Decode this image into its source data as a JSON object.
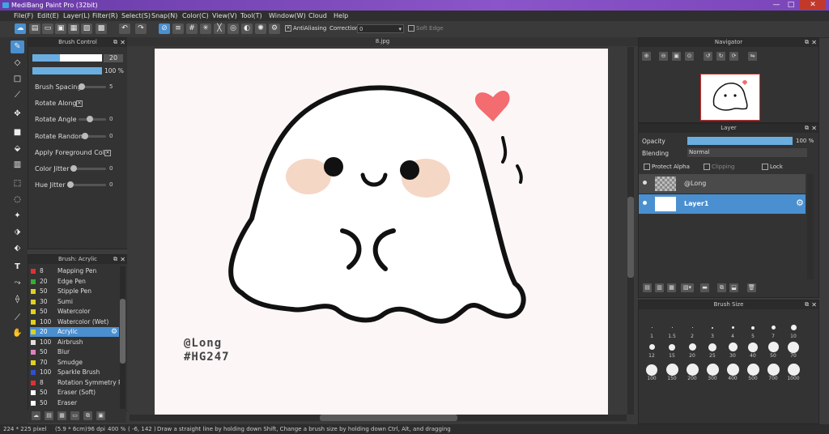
{
  "window": {
    "title": "MediBang Paint Pro (32bit)",
    "controls": [
      "—",
      "□",
      "✕"
    ]
  },
  "menu": [
    "File(F)",
    "Edit(E)",
    "Layer(L)",
    "Filter(R)",
    "Select(S)",
    "Snap(N)",
    "Color(C)",
    "View(V)",
    "Tool(T)",
    "Window(W)",
    "Cloud",
    "Help"
  ],
  "toolbar": {
    "antialiasing_label": "AntiAliasing",
    "correction_label": "Correction",
    "correction_value": "0",
    "soft_edge_label": "Soft Edge"
  },
  "brush_control": {
    "title": "Brush Control",
    "size_value": "20",
    "opacity_value": "100 %",
    "rows": [
      {
        "label": "Brush Spacing",
        "value": "5"
      },
      {
        "label": "Rotate Along",
        "value": ""
      },
      {
        "label": "Rotate Angle",
        "value": "0"
      },
      {
        "label": "Rotate Random",
        "value": "0"
      },
      {
        "label": "Apply Foreground Color",
        "value": ""
      },
      {
        "label": "Color Jitter",
        "value": "0"
      },
      {
        "label": "Hue Jitter",
        "value": "0"
      }
    ]
  },
  "brush_list": {
    "title": "Brush: Acrylic",
    "items": [
      {
        "size": "8",
        "name": "Mapping Pen",
        "color": "#e03030"
      },
      {
        "size": "20",
        "name": "Edge Pen",
        "color": "#30b030"
      },
      {
        "size": "50",
        "name": "Stipple Pen",
        "color": "#e0d020"
      },
      {
        "size": "30",
        "name": "Sumi",
        "color": "#e0d020"
      },
      {
        "size": "50",
        "name": "Watercolor",
        "color": "#e0d020"
      },
      {
        "size": "100",
        "name": "Watercolor (Wet)",
        "color": "#e0d020"
      },
      {
        "size": "20",
        "name": "Acrylic",
        "color": "#e0d020"
      },
      {
        "size": "100",
        "name": "Airbrush",
        "color": "#e0e0e0"
      },
      {
        "size": "50",
        "name": "Blur",
        "color": "#e080c0"
      },
      {
        "size": "70",
        "name": "Smudge",
        "color": "#e0d020"
      },
      {
        "size": "100",
        "name": "Sparkle Brush",
        "color": "#3050d0"
      },
      {
        "size": "8",
        "name": "Rotation Symmetry Pe",
        "color": "#e03030"
      },
      {
        "size": "50",
        "name": "Eraser (Soft)",
        "color": "#ffffff"
      },
      {
        "size": "50",
        "name": "Eraser",
        "color": "#ffffff"
      }
    ]
  },
  "canvas": {
    "tab": "8.jpg",
    "watermark_line1": "@Long",
    "watermark_line2": "#HG247"
  },
  "navigator": {
    "title": "Navigator"
  },
  "layer_panel": {
    "title": "Layer",
    "opacity_label": "Opacity",
    "opacity_value": "100 %",
    "blending_label": "Blending",
    "blending_value": "Normal",
    "protect_alpha": "Protect Alpha",
    "clipping": "Clipping",
    "lock": "Lock",
    "layers": [
      {
        "name": "@Long"
      },
      {
        "name": "Layer1"
      }
    ]
  },
  "brush_size": {
    "title": "Brush Size",
    "row1": [
      "1",
      "1.5",
      "2",
      "3",
      "4",
      "5",
      "7",
      "10"
    ],
    "row2": [
      "12",
      "15",
      "20",
      "25",
      "30",
      "40",
      "50",
      "70"
    ],
    "row3": [
      "100",
      "150",
      "200",
      "300",
      "400",
      "500",
      "700",
      "1000"
    ]
  },
  "status": {
    "size": "224 * 225 pixel",
    "cm": "(5.9 * 6cm)",
    "dpi": "96 dpi",
    "zoom": "400 %",
    "coords": "( -6, 142 )",
    "hint": "Draw a straight line by holding down Shift, Change a brush size by holding down Ctrl, Alt, and dragging"
  }
}
